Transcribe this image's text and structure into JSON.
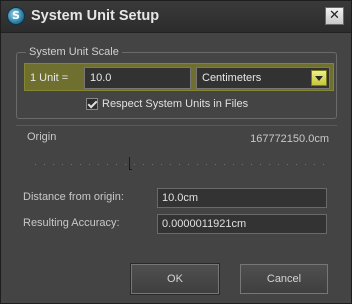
{
  "window": {
    "title": "System Unit Setup",
    "icon": "3dsmax-logo-icon",
    "close_glyph": "✕"
  },
  "scale": {
    "group_label": "System Unit Scale",
    "unit_label": "1 Unit =",
    "unit_value": "10.0",
    "unit_type": "Centimeters",
    "respect_label": "Respect System Units in Files",
    "respect_checked": true,
    "highlight_color": "#6f7030"
  },
  "origin": {
    "label": "Origin",
    "value": "167772150.0cm",
    "slider_fraction": 0.33
  },
  "fields": {
    "distance_label": "Distance from origin:",
    "distance_value": "10.0cm",
    "accuracy_label": "Resulting Accuracy:",
    "accuracy_value": "0.0000011921cm"
  },
  "buttons": {
    "ok": "OK",
    "cancel": "Cancel"
  }
}
